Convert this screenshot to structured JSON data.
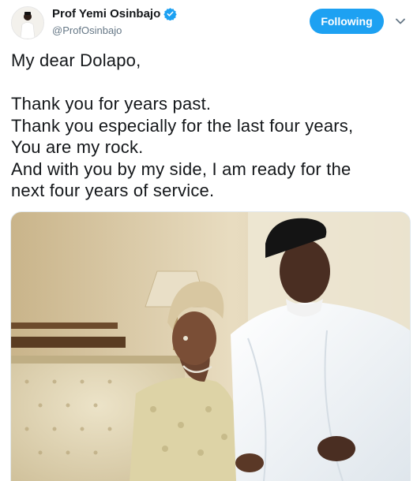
{
  "header": {
    "display_name": "Prof Yemi Osinbajo",
    "handle": "@ProfOsinbajo",
    "follow_label": "Following",
    "verified_icon": "verified-badge-icon",
    "menu_icon": "chevron-down-icon"
  },
  "tweet": {
    "lines": [
      "My dear Dolapo,",
      "",
      "Thank you for years past.",
      "Thank you especially for the last four years,",
      "You are my rock.",
      "And with you by my side, I am ready for the",
      "next four years of service."
    ]
  },
  "media": {
    "type": "photo"
  },
  "colors": {
    "accent": "#1da1f2",
    "text": "#14171a",
    "secondary": "#657786"
  }
}
